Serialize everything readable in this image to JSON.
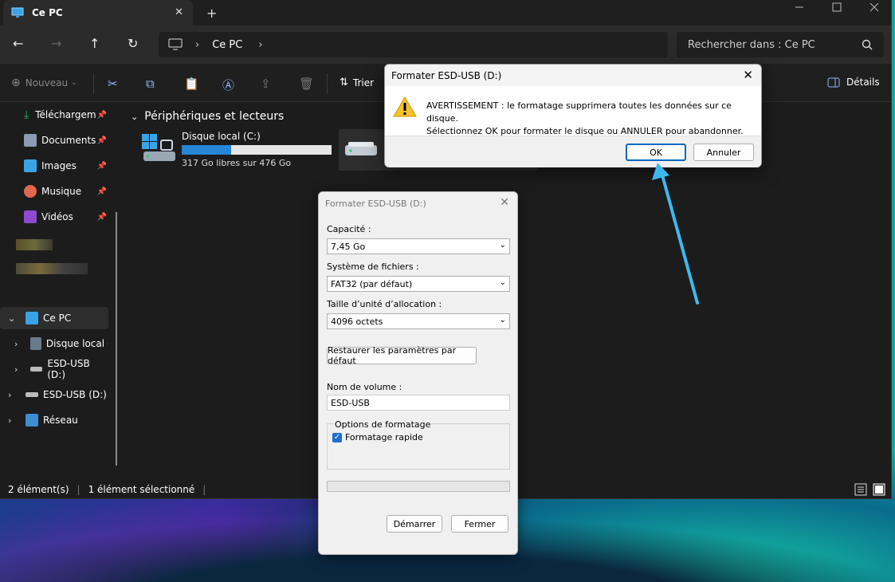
{
  "window": {
    "tab_title": "Ce PC",
    "new_tab": "+",
    "close_tab": "✕"
  },
  "address": {
    "back": "←",
    "forward": "→",
    "up": "↑",
    "refresh": "↻",
    "crumb": "Ce PC",
    "search_placeholder": "Rechercher dans : Ce PC"
  },
  "toolbar": {
    "new_label": "Nouveau",
    "sort_label": "Trier",
    "details_label": "Détails"
  },
  "sidebar": {
    "quick": [
      {
        "label": "Téléchargem",
        "color": "#1fb86b"
      },
      {
        "label": "Documents",
        "color": "#8c9bb1"
      },
      {
        "label": "Images",
        "color": "#3aa3e8"
      },
      {
        "label": "Musique",
        "color": "#e0684e"
      },
      {
        "label": "Vidéos",
        "color": "#8c4ad0"
      }
    ],
    "tree": [
      {
        "label": "Ce PC"
      },
      {
        "label": "Disque local (C"
      },
      {
        "label": "ESD-USB (D:)"
      },
      {
        "label": "ESD-USB (D:)"
      },
      {
        "label": "Réseau"
      }
    ]
  },
  "content": {
    "section_title": "Périphériques et lecteurs",
    "drive_c_name": "Disque local (C:)",
    "drive_c_free": "317 Go libres sur 476 Go",
    "drive_c_used_fraction": 0.33
  },
  "status": {
    "count": "2 élément(s)",
    "selected": "1 élément sélectionné"
  },
  "format_dialog": {
    "title": "Formater ESD-USB (D:)",
    "capacity_label": "Capacité :",
    "capacity_value": "7,45 Go",
    "fs_label": "Système de fichiers :",
    "fs_value": "FAT32 (par défaut)",
    "alloc_label": "Taille d’unité d’allocation :",
    "alloc_value": "4096 octets",
    "restore_button": "Restaurer les paramètres par défaut",
    "volume_label": "Nom de volume :",
    "volume_value": "ESD-USB",
    "options_label": "Options de formatage",
    "quick_format_label": "Formatage rapide",
    "start_button": "Démarrer",
    "close_button": "Fermer"
  },
  "alert_dialog": {
    "title": "Formater ESD-USB (D:)",
    "line1": "AVERTISSEMENT : le formatage supprimera toutes les données sur ce disque.",
    "line2": "Sélectionnez OK pour formater le disque ou ANNULER pour abandonner.",
    "ok_button": "OK",
    "cancel_button": "Annuler"
  }
}
